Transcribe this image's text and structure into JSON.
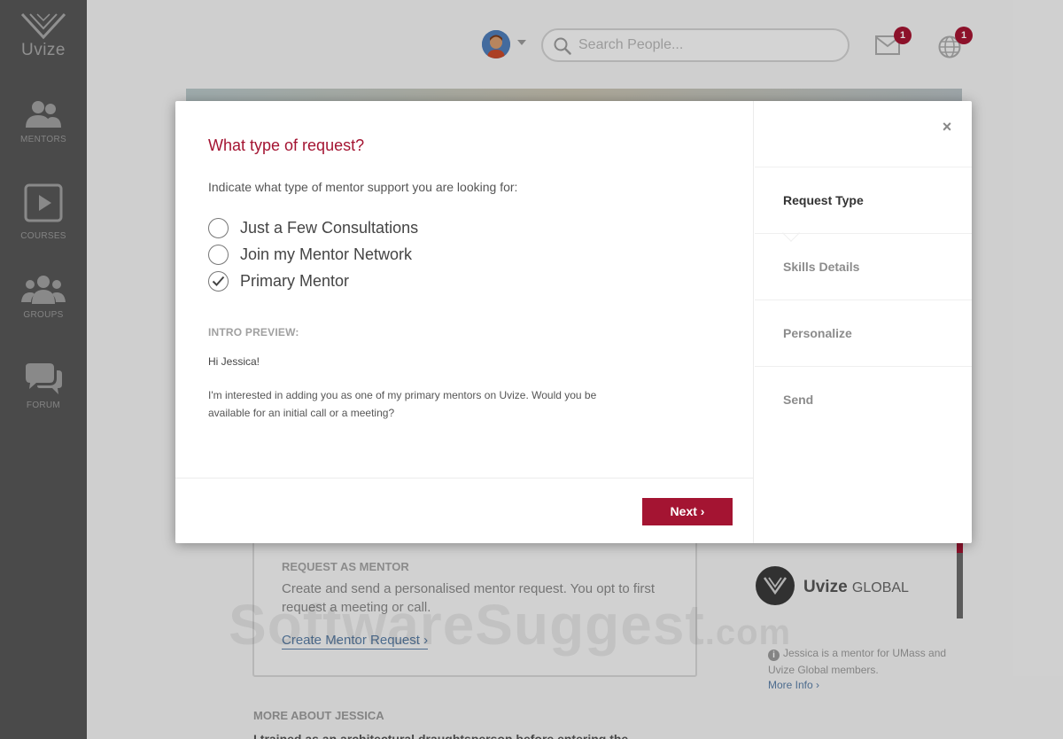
{
  "app": {
    "logo_text": "Uvize"
  },
  "sidebar": {
    "items": [
      {
        "label": "MENTORS",
        "icon": "people-icon"
      },
      {
        "label": "COURSES",
        "icon": "play-icon"
      },
      {
        "label": "GROUPS",
        "icon": "group-icon"
      },
      {
        "label": "FORUM",
        "icon": "chat-icon"
      }
    ]
  },
  "header": {
    "search_placeholder": "Search People...",
    "mail_count": "1",
    "globe_count": "1"
  },
  "background": {
    "request_title": "REQUEST AS MENTOR",
    "request_desc": "Create and send a personalised mentor request. You opt to first request a meeting or call.",
    "request_link": "Create Mentor Request ›",
    "more_about": "MORE ABOUT JESSICA",
    "more_text": "I trained as an architectural draughtsperson before entering the",
    "global_brand": "Uvize",
    "global_suffix": "GLOBAL",
    "mentor_info": "Jessica is a mentor for UMass and Uvize Global members.",
    "more_info": "More Info ›",
    "watermark": "SoftwareSuggest",
    "watermark_suffix": ".com"
  },
  "modal": {
    "title": "What type of request?",
    "subtitle": "Indicate what type of mentor support you are looking for:",
    "options": [
      {
        "label": "Just a Few Consultations",
        "checked": false
      },
      {
        "label": "Join my Mentor Network",
        "checked": false
      },
      {
        "label": "Primary Mentor",
        "checked": true
      }
    ],
    "intro_title": "INTRO PREVIEW:",
    "intro_greeting": "Hi Jessica!",
    "intro_body": "I'm interested in adding you as one of my primary mentors on Uvize. Would you be available for an initial call or a meeting?",
    "next_label": "Next ›",
    "close_label": "×",
    "steps": [
      {
        "label": "Request Type",
        "active": true
      },
      {
        "label": "Skills Details",
        "active": false
      },
      {
        "label": "Personalize",
        "active": false
      },
      {
        "label": "Send",
        "active": false
      }
    ]
  },
  "colors": {
    "accent": "#a41432",
    "sidebar": "#575757",
    "link": "#5a7ea6"
  }
}
